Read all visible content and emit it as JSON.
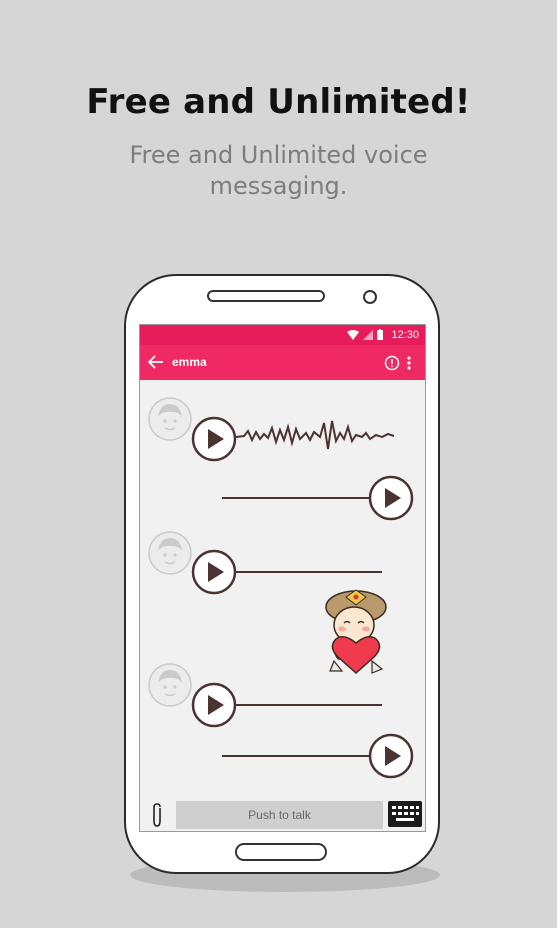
{
  "promo": {
    "headline": "Free and Unlimited!",
    "subline": "Free and Unlimited voice messaging."
  },
  "statusbar": {
    "time": "12:30",
    "icons": [
      "wifi-icon",
      "signal-icon",
      "battery-icon"
    ]
  },
  "appbar": {
    "title": "emma",
    "icons": [
      "back-arrow-icon",
      "info-icon",
      "more-vert-icon"
    ]
  },
  "messages": [
    {
      "from": "contact",
      "type": "voice",
      "state": "playing-waveform"
    },
    {
      "from": "me",
      "type": "voice"
    },
    {
      "from": "contact",
      "type": "voice"
    },
    {
      "from": "me",
      "type": "sticker",
      "sticker": "character-holding-heart"
    },
    {
      "from": "contact",
      "type": "voice"
    },
    {
      "from": "me",
      "type": "voice"
    }
  ],
  "composer": {
    "push_label": "Push to talk",
    "icons": [
      "paperclip-icon",
      "keyboard-icon"
    ]
  },
  "colors": {
    "accent": "#ef2a63",
    "statusbar": "#e61d5a",
    "voice_brown": "#4a3330"
  }
}
